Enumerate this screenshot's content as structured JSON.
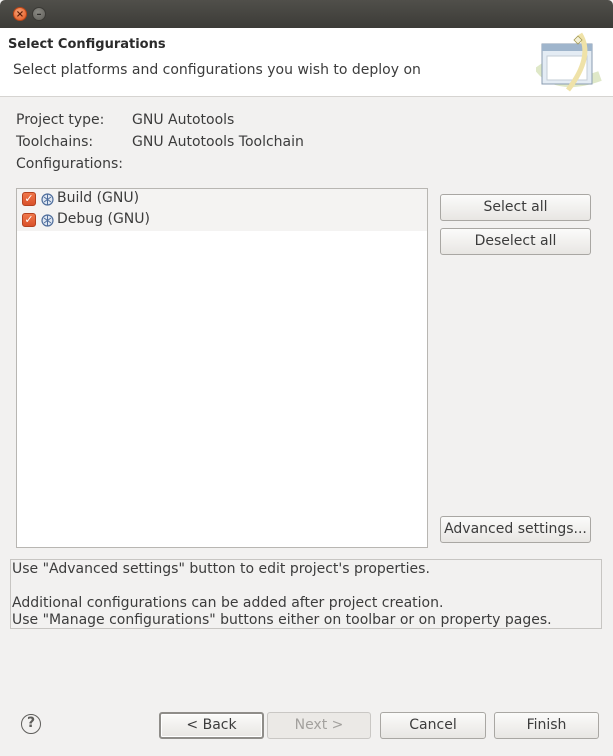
{
  "window": {
    "close_glyph": "×",
    "minimize_glyph": "–"
  },
  "header": {
    "title": "Select Configurations",
    "description": "Select platforms and configurations you wish to deploy on",
    "wizard_icon": "wizard-banner-icon"
  },
  "project": {
    "type_label": "Project type:",
    "type_value": "GNU Autotools",
    "toolchains_label": "Toolchains:",
    "toolchains_value": "GNU Autotools Toolchain",
    "configurations_label": "Configurations:"
  },
  "configurations": [
    {
      "label": "Build (GNU)",
      "checked": true,
      "icon": "configuration-icon"
    },
    {
      "label": "Debug (GNU)",
      "checked": true,
      "icon": "configuration-icon"
    }
  ],
  "buttons": {
    "select_all": "Select all",
    "deselect_all": "Deselect all",
    "advanced_settings": "Advanced settings...",
    "back": "< Back",
    "next": "Next >",
    "cancel": "Cancel",
    "finish": "Finish"
  },
  "info": {
    "line1": "Use \"Advanced settings\" button to edit project's properties.",
    "line2": "Additional configurations can be added after project creation.",
    "line3": "Use \"Manage configurations\" buttons either on toolbar or on property pages."
  },
  "help": {
    "glyph": "?"
  },
  "colors": {
    "checkbox": "#e05a2b",
    "titlebar": "#3c3b37",
    "background": "#f2f1f0"
  }
}
